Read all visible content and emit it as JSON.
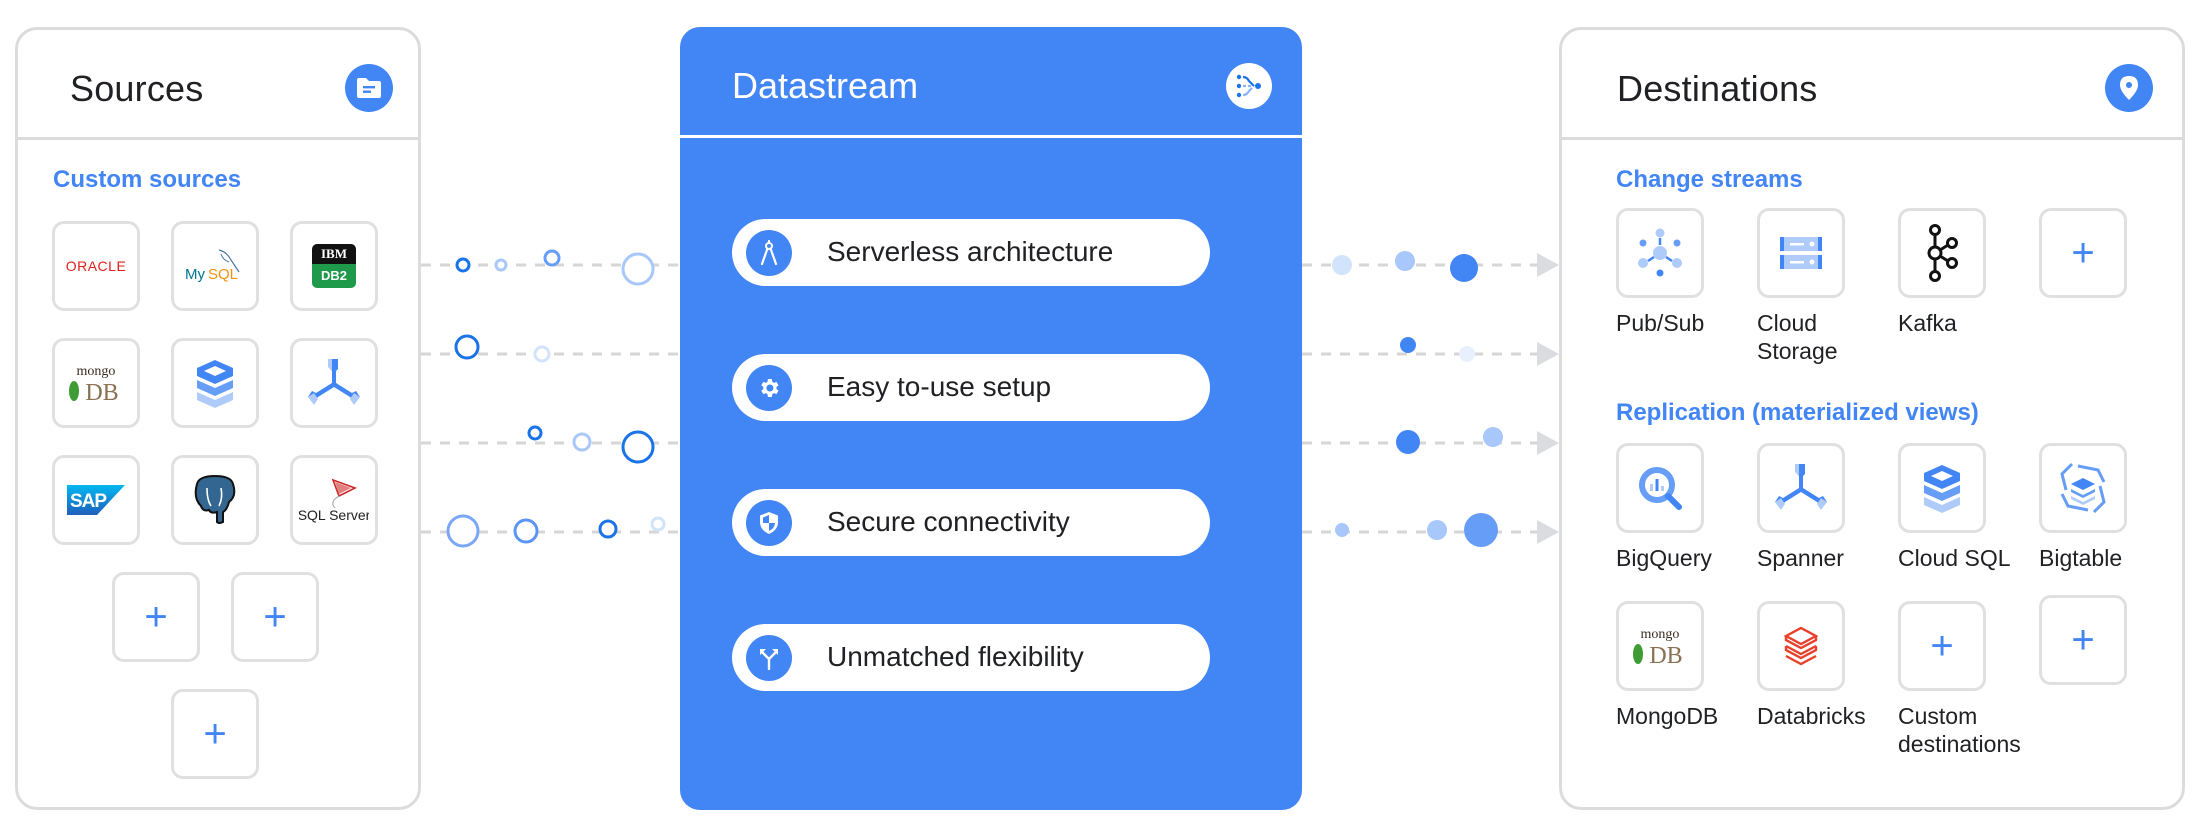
{
  "sources": {
    "title": "Sources",
    "header_icon": "folder-icon",
    "section_label": "Custom sources",
    "items": [
      {
        "name": "Oracle",
        "icon": "oracle-logo"
      },
      {
        "name": "MySQL",
        "icon": "mysql-logo"
      },
      {
        "name": "IBM DB2",
        "icon": "ibm-db2-logo",
        "text_top": "IBM",
        "text_bottom": "DB2"
      },
      {
        "name": "MongoDB",
        "icon": "mongodb-logo"
      },
      {
        "name": "Cloud SQL",
        "icon": "cloud-sql-icon"
      },
      {
        "name": "Spanner",
        "icon": "spanner-icon"
      },
      {
        "name": "SAP",
        "icon": "sap-logo"
      },
      {
        "name": "PostgreSQL",
        "icon": "postgresql-logo"
      },
      {
        "name": "SQL Server",
        "icon": "sql-server-logo"
      }
    ],
    "add_buttons": [
      "+",
      "+",
      "+"
    ]
  },
  "datastream": {
    "title": "Datastream",
    "header_icon": "datastream-icon",
    "features": [
      {
        "label": "Serverless architecture",
        "icon": "compass-icon"
      },
      {
        "label": "Easy to-use setup",
        "icon": "gear-icon"
      },
      {
        "label": "Secure connectivity",
        "icon": "shield-icon"
      },
      {
        "label": "Unmatched flexibility",
        "icon": "fork-arrows-icon"
      }
    ]
  },
  "destinations": {
    "title": "Destinations",
    "header_icon": "location-pin-icon",
    "change_streams": {
      "label": "Change streams",
      "items": [
        {
          "name": "Pub/Sub",
          "label_lines": [
            "Pub/Sub"
          ],
          "icon": "pubsub-icon"
        },
        {
          "name": "Cloud Storage",
          "label_lines": [
            "Cloud",
            "Storage"
          ],
          "icon": "cloud-storage-icon"
        },
        {
          "name": "Kafka",
          "label_lines": [
            "Kafka"
          ],
          "icon": "kafka-icon"
        },
        {
          "name": "Add",
          "label_lines": [],
          "icon": "plus-icon"
        }
      ]
    },
    "replication": {
      "label": "Replication (materialized views)",
      "items": [
        {
          "name": "BigQuery",
          "label_lines": [
            "BigQuery"
          ],
          "icon": "bigquery-icon"
        },
        {
          "name": "Spanner",
          "label_lines": [
            "Spanner"
          ],
          "icon": "spanner-icon"
        },
        {
          "name": "Cloud SQL",
          "label_lines": [
            "Cloud SQL"
          ],
          "icon": "cloud-sql-icon"
        },
        {
          "name": "Bigtable",
          "label_lines": [
            "Bigtable"
          ],
          "icon": "bigtable-icon"
        },
        {
          "name": "MongoDB",
          "label_lines": [
            "MongoDB"
          ],
          "icon": "mongodb-logo"
        },
        {
          "name": "Databricks",
          "label_lines": [
            "Databricks"
          ],
          "icon": "databricks-icon"
        },
        {
          "name": "Custom destinations",
          "label_lines": [
            "Custom",
            "destinations"
          ],
          "icon": "plus-icon"
        },
        {
          "name": "Add",
          "label_lines": [],
          "icon": "plus-icon"
        }
      ]
    }
  },
  "colors": {
    "accent": "#4285f4",
    "accent_dark": "#1a73e8",
    "accent_light": "#a8c7fa",
    "accent_lighter": "#d2e3fc",
    "border": "#dcdcdc",
    "dash": "#d6d6d6",
    "text": "#202124"
  }
}
